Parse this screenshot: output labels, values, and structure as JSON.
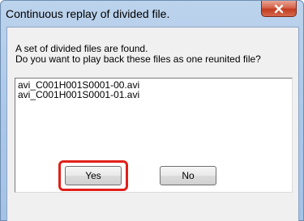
{
  "window": {
    "title": "Continuous replay of divided file."
  },
  "message": {
    "line1": "A set of divided files are found.",
    "line2": "Do you want to play back these files as one reunited file?"
  },
  "files": [
    "avi_C001H001S0001-00.avi",
    "avi_C001H001S0001-01.avi"
  ],
  "buttons": {
    "yes_label": "Yes",
    "no_label": "No"
  },
  "colors": {
    "highlight": "#e0201a",
    "close_button": "#c23c20",
    "title_gradient": "#a9c6e8"
  },
  "icons": {
    "close": "close-icon"
  }
}
